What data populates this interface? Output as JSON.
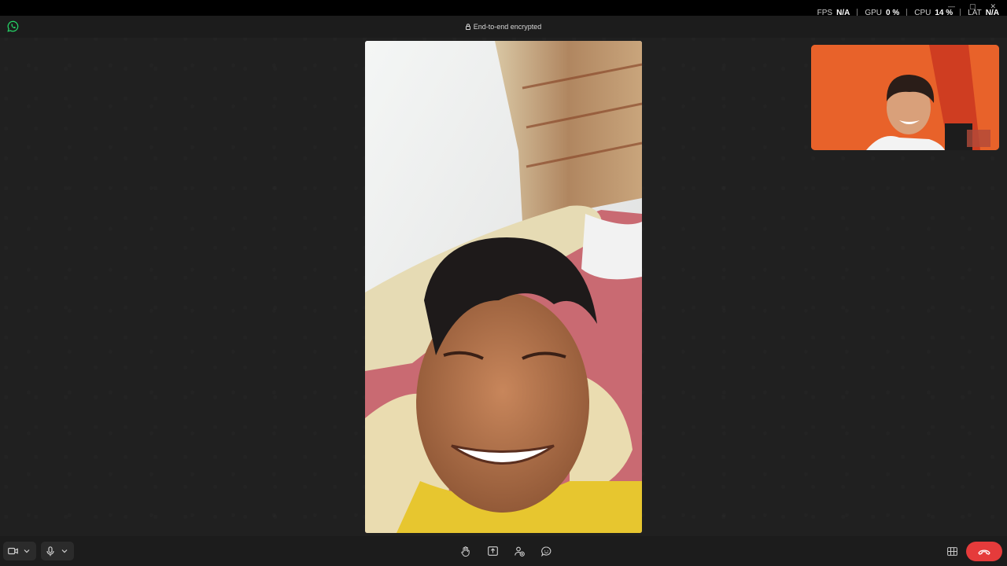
{
  "perf": {
    "fps": {
      "label": "FPS",
      "value": "N/A"
    },
    "gpu": {
      "label": "GPU",
      "value": "0 %"
    },
    "cpu": {
      "label": "CPU",
      "value": "14 %"
    },
    "lat": {
      "label": "LAT",
      "value": "N/A"
    }
  },
  "title_bar": {
    "encryption_text": "End-to-end encrypted",
    "icons": [
      "whatsapp-logo",
      "lock-icon"
    ]
  },
  "colors": {
    "background": "#202020",
    "bar": "#1c1c1c",
    "end_call": "#e53b3b",
    "whatsapp_green": "#25d366"
  },
  "controls": {
    "video": [
      "video-camera-icon",
      "chevron-down-icon"
    ],
    "mic": [
      "microphone-icon",
      "chevron-down-icon"
    ],
    "center": [
      "raise-hand-icon",
      "share-screen-icon",
      "add-participant-icon",
      "reactions-icon"
    ],
    "right": [
      "layout-grid-icon",
      "end-call-icon"
    ]
  }
}
